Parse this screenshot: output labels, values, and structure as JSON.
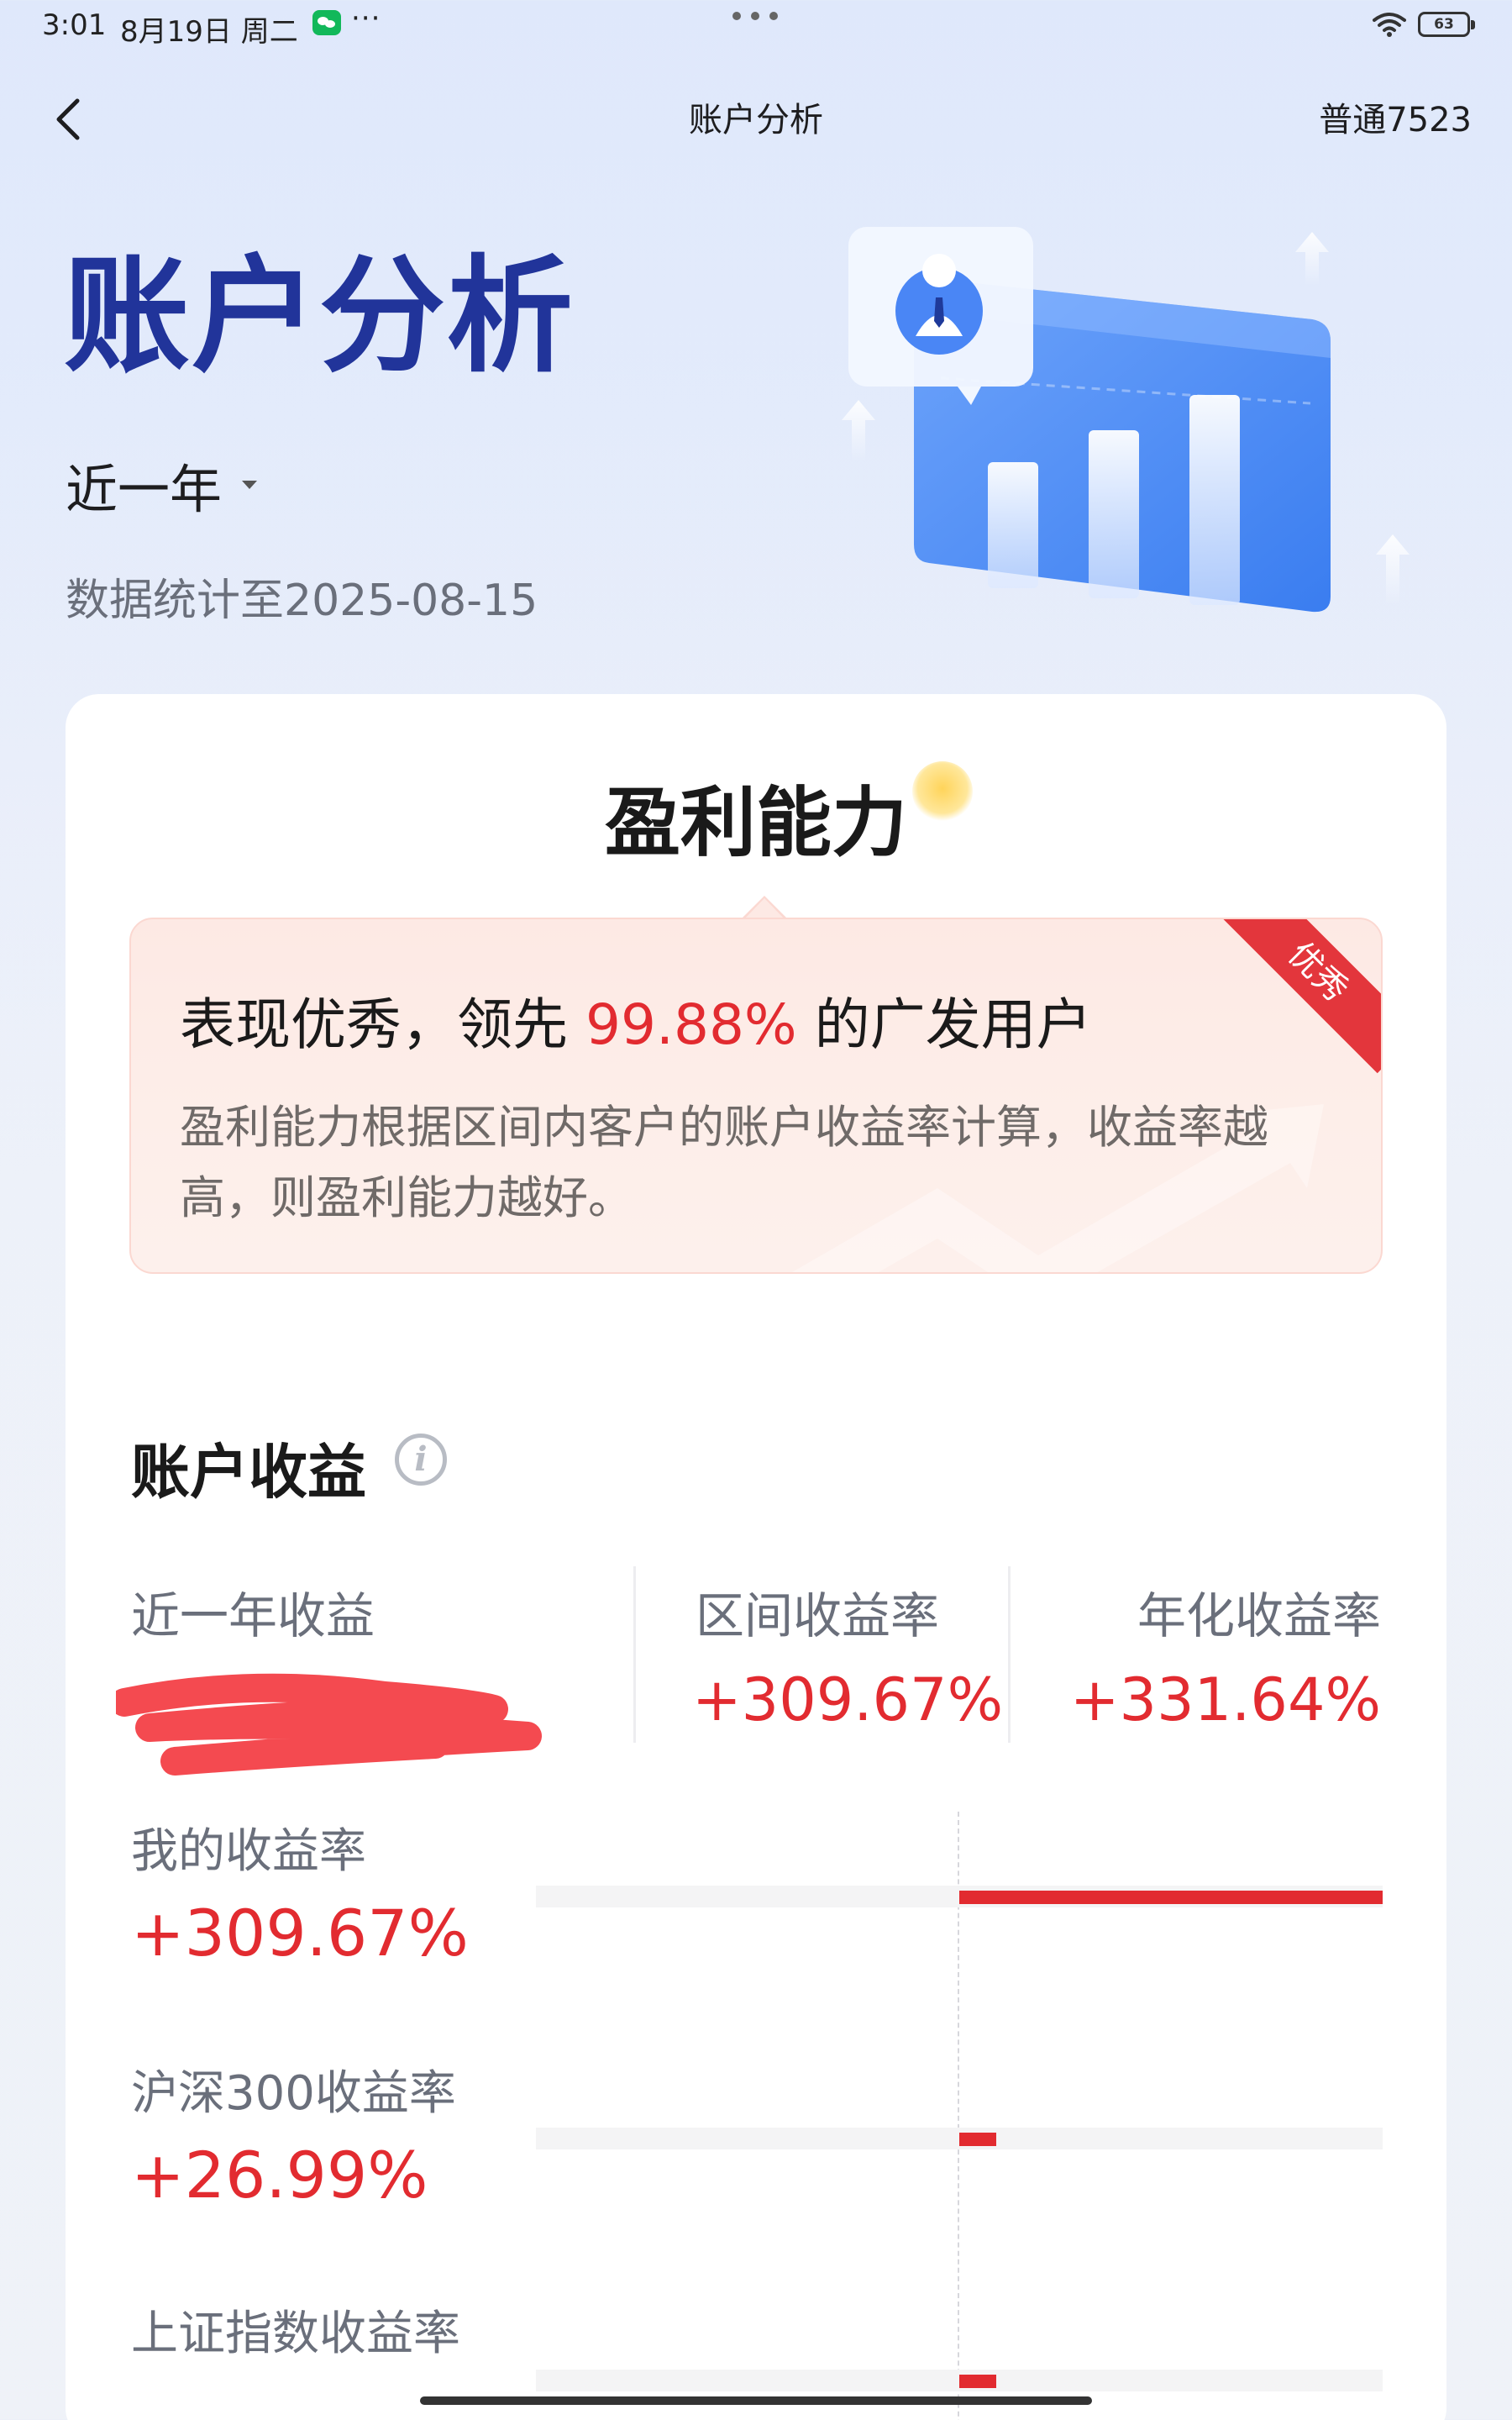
{
  "status_bar": {
    "time": "3:01",
    "date": "8月19日 周二",
    "dots": "···",
    "battery": "63",
    "icons": [
      "wechat-icon",
      "wifi-icon",
      "battery-icon"
    ]
  },
  "nav": {
    "back_icon": "chevron-left-icon",
    "title": "账户分析",
    "account": "普通7523"
  },
  "hero": {
    "title": "账户分析",
    "period": "近一年",
    "data_date": "数据统计至2025-08-15"
  },
  "profit": {
    "title": "盈利能力",
    "badge": "优秀",
    "headline_prefix": "表现优秀，领先 ",
    "headline_percent": "99.88%",
    "headline_suffix": " 的广发用户",
    "description": "盈利能力根据区间内客户的账户收益率计算，收益率越高，则盈利能力越好。"
  },
  "earnings": {
    "title": "账户收益",
    "metrics": [
      {
        "label": "近一年收益",
        "value": ""
      },
      {
        "label": "区间收益率",
        "value": "+309.67%"
      },
      {
        "label": "年化收益率",
        "value": "+331.64%"
      }
    ],
    "comparisons": [
      {
        "label": "我的收益率",
        "value": "+309.67%",
        "rate": 309.67
      },
      {
        "label": "沪深300收益率",
        "value": "+26.99%",
        "rate": 26.99
      },
      {
        "label": "上证指数收益率",
        "value": "",
        "rate": 26.99
      }
    ]
  },
  "colors": {
    "accent_red": "#e22b30",
    "title_blue": "#21349a",
    "background": "#e3ebfb"
  }
}
